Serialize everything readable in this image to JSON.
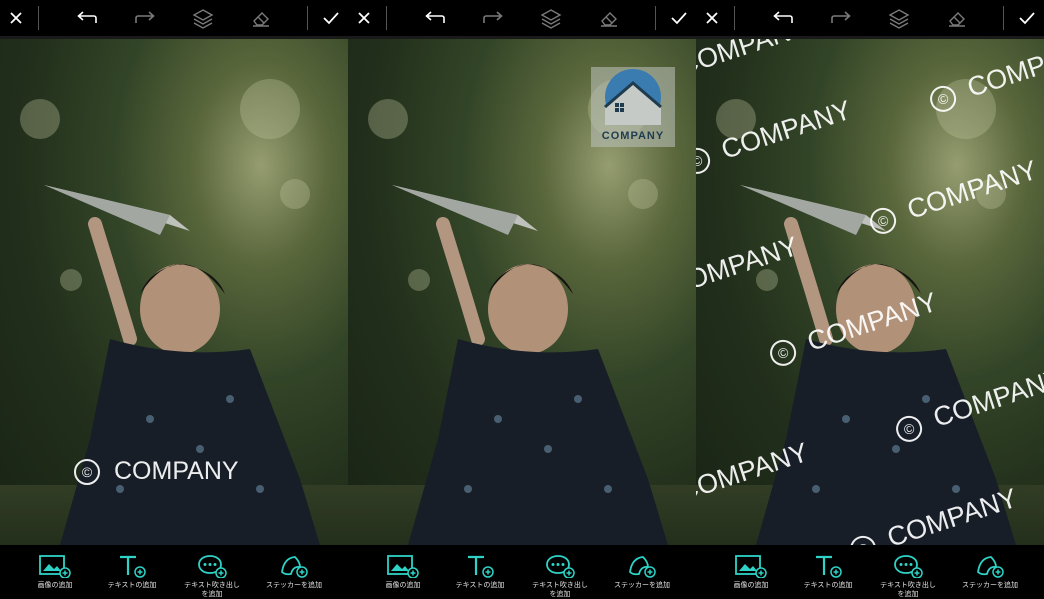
{
  "screens": [
    {
      "watermark_type": "text-single",
      "watermark": {
        "symbol": "©",
        "text": "COMPANY"
      }
    },
    {
      "watermark_type": "logo",
      "logo": {
        "text": "COMPANY"
      }
    },
    {
      "watermark_type": "text-tiled",
      "watermark": {
        "symbol": "©",
        "text": "COMPANY"
      }
    }
  ],
  "toolbar": {
    "icons": [
      "close-icon",
      "undo-icon",
      "redo-icon",
      "layers-icon",
      "eraser-icon",
      "check-icon"
    ]
  },
  "bottom_tools": [
    {
      "icon": "add-image-icon",
      "label": "画像の追加"
    },
    {
      "icon": "add-text-icon",
      "label": "テキストの追加"
    },
    {
      "icon": "add-speech-bubble-icon",
      "label": "テキスト吹き出し\nを追加"
    },
    {
      "icon": "add-sticker-icon",
      "label": "ステッカーを追加"
    }
  ],
  "colors": {
    "accent": "#2ed3c6",
    "bar": "#000000",
    "icon_active": "#ffffff",
    "icon_disabled": "#7a7a7a"
  }
}
